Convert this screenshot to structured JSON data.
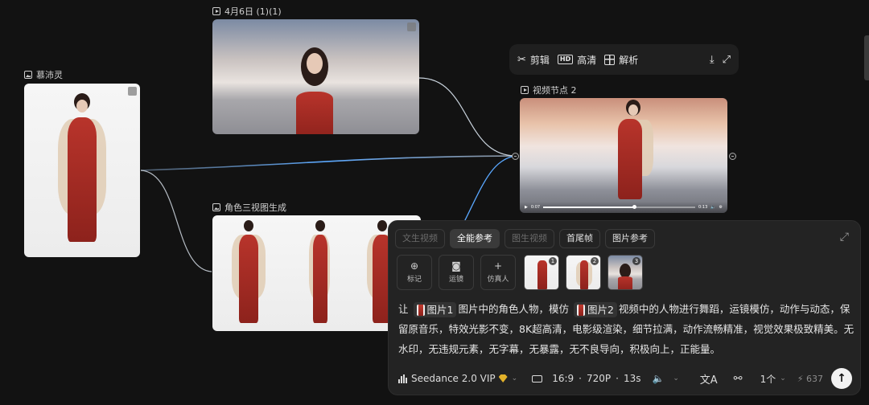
{
  "nodes": {
    "character": {
      "title": "慕沛灵"
    },
    "video_source": {
      "title": "4月6日 (1)(1)"
    },
    "three_view": {
      "title": "角色三视图生成"
    },
    "video_node": {
      "title": "视频节点 2",
      "time_current": "0:07",
      "time_total": "0:13",
      "progress": 0.6
    }
  },
  "toolbar": {
    "edit_label": "剪辑",
    "hd_badge": "HD",
    "hd_label": "高清",
    "analyze_label": "解析"
  },
  "panel": {
    "tabs": [
      {
        "label": "文生视频",
        "state": "disabled"
      },
      {
        "label": "全能参考",
        "state": "active"
      },
      {
        "label": "图生视频",
        "state": "disabled"
      },
      {
        "label": "首尾帧",
        "state": "normal"
      },
      {
        "label": "图片参考",
        "state": "normal"
      }
    ],
    "tools": [
      {
        "label": "标记",
        "icon": "mark-icon"
      },
      {
        "label": "运镜",
        "icon": "camera-icon"
      },
      {
        "label": "仿真人",
        "icon": "plus-icon"
      }
    ],
    "refs": [
      "1",
      "2",
      "3"
    ],
    "prompt": {
      "p1": "让",
      "chip1": "图片1",
      "p2": "图片中的角色人物，模仿",
      "chip2": "图片2",
      "p3": "视频中的人物进行舞蹈，运镜模仿，动作与动态，保留原音乐，特效光影不变，8K超高清，电影级渲染，细节拉满，动作流畅精准，视觉效果极致精美。无水印，无违规元素，无字幕，无暴露，无不良导向，积极向上，正能量。"
    },
    "model": "Seedance 2.0 VIP",
    "ratio": "16:9",
    "resolution": "720P",
    "duration": "13s",
    "dot": "·",
    "count": "1个",
    "credits": "637"
  }
}
